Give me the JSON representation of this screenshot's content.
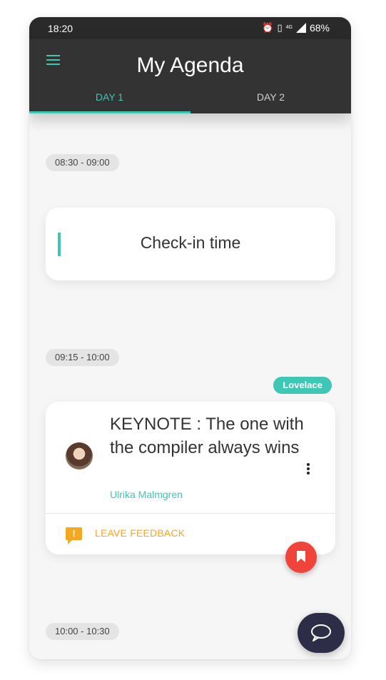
{
  "status_bar": {
    "time": "18:20",
    "network_label": "4G",
    "battery": "68%"
  },
  "app_bar": {
    "title": "My Agenda",
    "tabs": [
      {
        "label": "DAY 1",
        "selected": true
      },
      {
        "label": "DAY 2",
        "selected": false
      }
    ]
  },
  "agenda": {
    "slots": [
      {
        "time": "08:30 - 09:00",
        "session": {
          "title": "Check-in time"
        }
      },
      {
        "time": "09:15 - 10:00",
        "room": "Lovelace",
        "session": {
          "title": "KEYNOTE : The one with the compiler always wins",
          "speaker": "Ulrika Malmgren",
          "feedback_label": "LEAVE FEEDBACK"
        }
      },
      {
        "time": "10:00 - 10:30"
      }
    ]
  },
  "colors": {
    "accent": "#3cc8b4",
    "appbar": "#333333",
    "feedback": "#f5a623",
    "bookmark": "#f0443a",
    "chat": "#2d2d47"
  }
}
